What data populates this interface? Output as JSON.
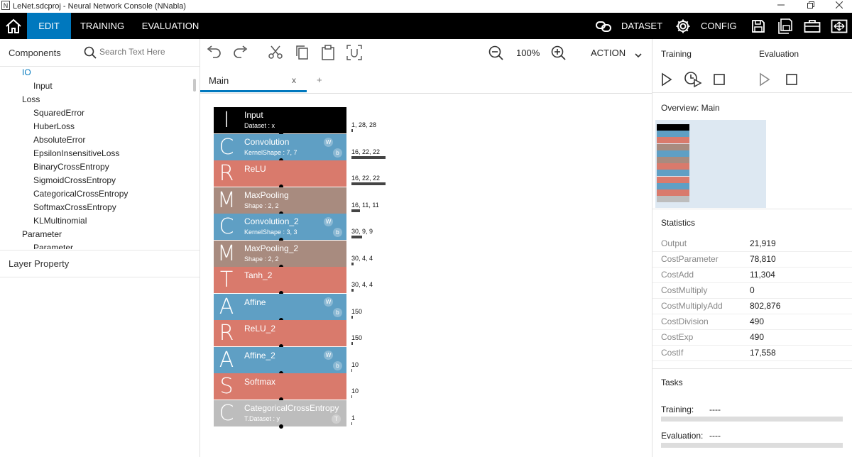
{
  "window": {
    "app_icon": "N",
    "title": "LeNet.sdcproj - Neural Network Console (NNabla)",
    "minimize_icon": "minimize-icon",
    "maximize_icon": "maximize-icon",
    "close_icon": "close-icon"
  },
  "menubar": {
    "home_icon": "home-icon",
    "tabs": [
      {
        "label": "EDIT",
        "active": true
      },
      {
        "label": "TRAINING",
        "active": false
      },
      {
        "label": "EVALUATION",
        "active": false
      }
    ],
    "dataset_label": "DATASET",
    "config_label": "CONFIG",
    "accent_color": "#0078be"
  },
  "left_panel": {
    "components_title": "Components",
    "search_placeholder": "Search Text Here",
    "tree": [
      {
        "label": "IO",
        "level": 1,
        "selected": true
      },
      {
        "label": "Input",
        "level": 2
      },
      {
        "label": "Loss",
        "level": 1
      },
      {
        "label": "SquaredError",
        "level": 2
      },
      {
        "label": "HuberLoss",
        "level": 2
      },
      {
        "label": "AbsoluteError",
        "level": 2
      },
      {
        "label": "EpsilonInsensitiveLoss",
        "level": 2
      },
      {
        "label": "BinaryCrossEntropy",
        "level": 2
      },
      {
        "label": "SigmoidCrossEntropy",
        "level": 2
      },
      {
        "label": "CategoricalCrossEntropy",
        "level": 2
      },
      {
        "label": "SoftmaxCrossEntropy",
        "level": 2
      },
      {
        "label": "KLMultinomial",
        "level": 2
      },
      {
        "label": "Parameter",
        "level": 1
      },
      {
        "label": "Parameter",
        "level": 2
      }
    ],
    "layer_property_title": "Layer Property"
  },
  "toolbar": {
    "zoom": "100%",
    "action_label": "ACTION"
  },
  "tabs": {
    "main_label": "Main",
    "close_label": "x",
    "add_label": "+"
  },
  "network": {
    "layers": [
      {
        "letter": "I",
        "name": "Input",
        "sub": "Dataset : x",
        "color": "#000000",
        "badges": [],
        "shape": "1, 28, 28",
        "bar": 0.03
      },
      {
        "letter": "C",
        "name": "Convolution",
        "sub": "KernelShape : 7, 7",
        "color": "#5f9fc4",
        "badges": [
          "W",
          "b"
        ],
        "shape": "16, 22, 22",
        "bar": 0.85
      },
      {
        "letter": "R",
        "name": "ReLU",
        "sub": "",
        "color": "#d97a6c",
        "badges": [],
        "shape": "16, 22, 22",
        "bar": 0.85
      },
      {
        "letter": "M",
        "name": "MaxPooling",
        "sub": "Shape : 2, 2",
        "color": "#a88b7f",
        "badges": [],
        "shape": "16, 11, 11",
        "bar": 0.21
      },
      {
        "letter": "C",
        "name": "Convolution_2",
        "sub": "KernelShape : 3, 3",
        "color": "#5f9fc4",
        "badges": [
          "W",
          "b"
        ],
        "shape": "30, 9, 9",
        "bar": 0.26
      },
      {
        "letter": "M",
        "name": "MaxPooling_2",
        "sub": "Shape : 2, 2",
        "color": "#a88b7f",
        "badges": [],
        "shape": "30, 4, 4",
        "bar": 0.05
      },
      {
        "letter": "T",
        "name": "Tanh_2",
        "sub": "",
        "color": "#d97a6c",
        "badges": [],
        "shape": "30, 4, 4",
        "bar": 0.05
      },
      {
        "letter": "A",
        "name": "Affine",
        "sub": "",
        "color": "#5f9fc4",
        "badges": [
          "W",
          "b"
        ],
        "shape": "150",
        "bar": 0.02
      },
      {
        "letter": "R",
        "name": "ReLU_2",
        "sub": "",
        "color": "#d97a6c",
        "badges": [],
        "shape": "150",
        "bar": 0.02
      },
      {
        "letter": "A",
        "name": "Affine_2",
        "sub": "",
        "color": "#5f9fc4",
        "badges": [
          "W",
          "b"
        ],
        "shape": "10",
        "bar": 0.0
      },
      {
        "letter": "S",
        "name": "Softmax",
        "sub": "",
        "color": "#d97a6c",
        "badges": [],
        "shape": "10",
        "bar": 0.0
      },
      {
        "letter": "C",
        "name": "CategoricalCrossEntropy",
        "sub": "T.Dataset : y",
        "color": "#bdbdbd",
        "badges": [
          "T"
        ],
        "shape": "1",
        "bar": 0.0
      }
    ]
  },
  "right_panel": {
    "training_label": "Training",
    "evaluation_label": "Evaluation",
    "overview_title": "Overview: Main",
    "statistics_title": "Statistics",
    "stats": [
      {
        "label": "Output",
        "value": "21,919"
      },
      {
        "label": "CostParameter",
        "value": "78,810"
      },
      {
        "label": "CostAdd",
        "value": "11,304"
      },
      {
        "label": "CostMultiply",
        "value": "0"
      },
      {
        "label": "CostMultiplyAdd",
        "value": "802,876"
      },
      {
        "label": "CostDivision",
        "value": "490"
      },
      {
        "label": "CostExp",
        "value": "490"
      },
      {
        "label": "CostIf",
        "value": "17,558"
      }
    ],
    "tasks_title": "Tasks",
    "tasks": [
      {
        "label": "Training:",
        "value": "----"
      },
      {
        "label": "Evaluation:",
        "value": "----"
      }
    ]
  }
}
